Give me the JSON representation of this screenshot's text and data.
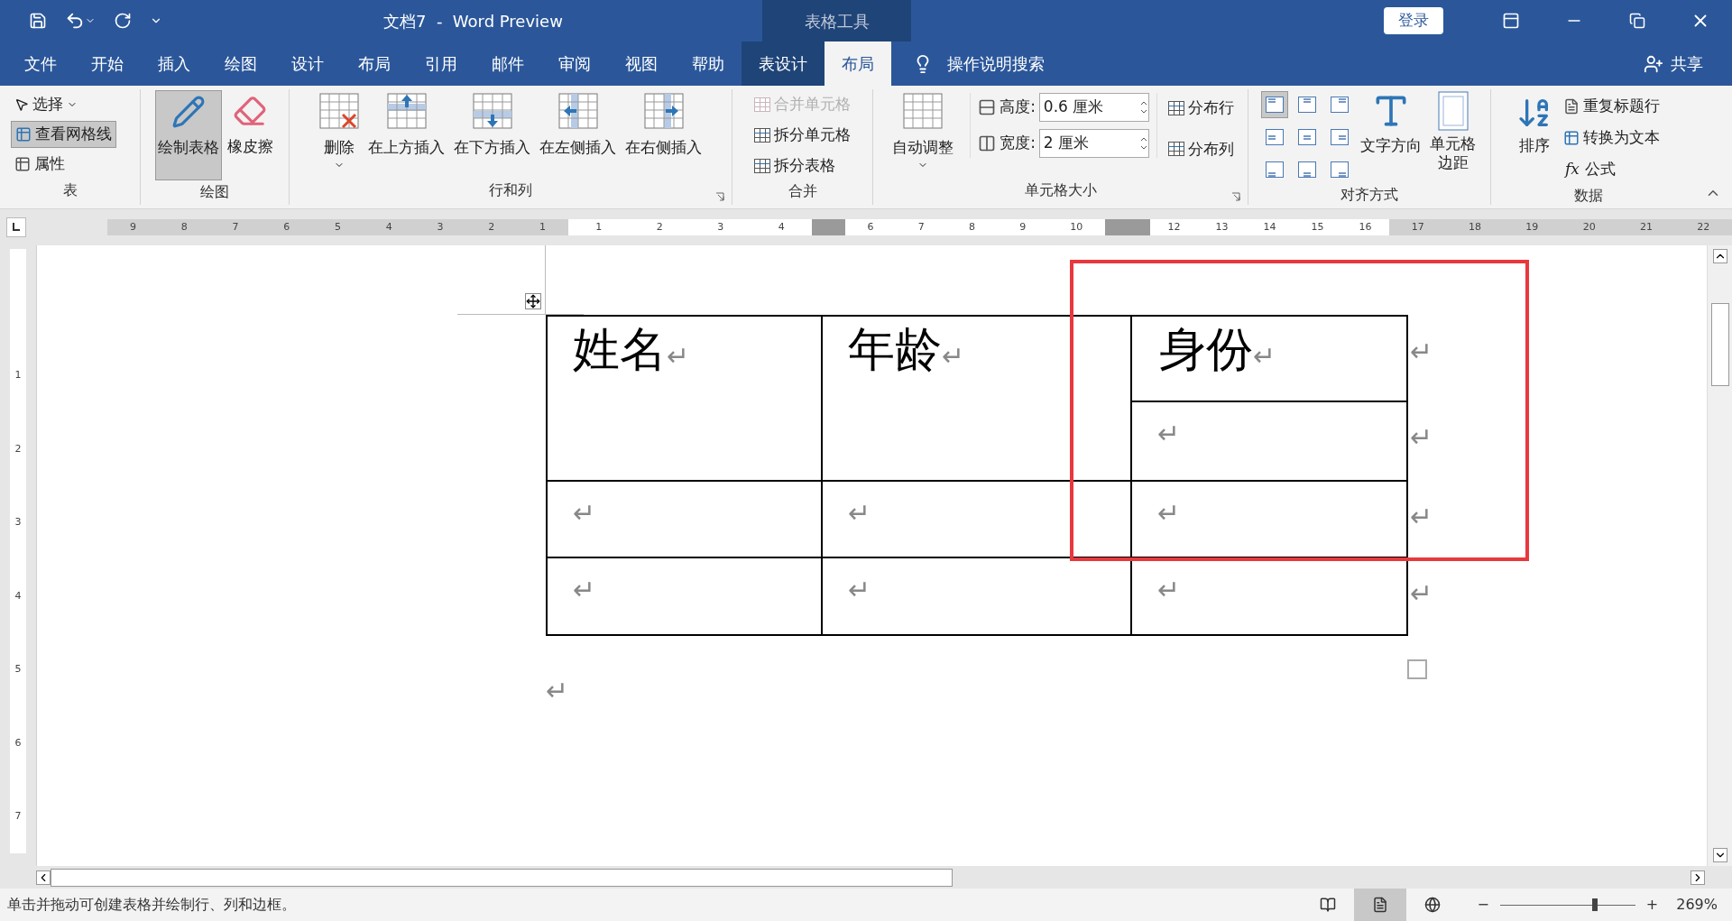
{
  "title_bar": {
    "title": "文档7  -  Word Preview",
    "context_label": "表格工具",
    "sign_in": "登录"
  },
  "tabs": [
    {
      "label": "文件",
      "selected": false,
      "kind": "normal"
    },
    {
      "label": "开始",
      "selected": false,
      "kind": "normal"
    },
    {
      "label": "插入",
      "selected": false,
      "kind": "normal"
    },
    {
      "label": "绘图",
      "selected": false,
      "kind": "normal"
    },
    {
      "label": "设计",
      "selected": false,
      "kind": "normal"
    },
    {
      "label": "布局",
      "selected": false,
      "kind": "normal"
    },
    {
      "label": "引用",
      "selected": false,
      "kind": "normal"
    },
    {
      "label": "邮件",
      "selected": false,
      "kind": "normal"
    },
    {
      "label": "审阅",
      "selected": false,
      "kind": "normal"
    },
    {
      "label": "视图",
      "selected": false,
      "kind": "normal"
    },
    {
      "label": "帮助",
      "selected": false,
      "kind": "normal"
    },
    {
      "label": "表设计",
      "selected": false,
      "kind": "context"
    },
    {
      "label": "布局",
      "selected": true,
      "kind": "context"
    }
  ],
  "tell_me": "操作说明搜索",
  "share": "共享",
  "ribbon": {
    "groups": [
      {
        "label": "表",
        "items": [
          {
            "label": "选择",
            "selected": false
          },
          {
            "label": "查看网格线",
            "selected": true
          },
          {
            "label": "属性",
            "selected": false
          }
        ]
      },
      {
        "label": "绘图",
        "items": [
          {
            "label": "绘制表格",
            "selected": true
          },
          {
            "label": "橡皮擦",
            "selected": false
          }
        ]
      },
      {
        "label": "行和列",
        "items": [
          {
            "label": "删除"
          },
          {
            "label": "在上方插入"
          },
          {
            "label": "在下方插入"
          },
          {
            "label": "在左侧插入"
          },
          {
            "label": "在右侧插入"
          }
        ]
      },
      {
        "label": "合并",
        "items": [
          {
            "label": "合并单元格",
            "disabled": true
          },
          {
            "label": "拆分单元格",
            "disabled": false
          },
          {
            "label": "拆分表格",
            "disabled": false
          }
        ]
      },
      {
        "label": "单元格大小",
        "autofit": "自动调整",
        "height_label": "高度:",
        "height_value": "0.6 厘米",
        "width_label": "宽度:",
        "width_value": "2 厘米",
        "items": [
          {
            "label": "分布行"
          },
          {
            "label": "分布列"
          }
        ]
      },
      {
        "label": "对齐方式",
        "align": [
          {
            "selected": true
          },
          {
            "selected": false
          },
          {
            "selected": false
          },
          {
            "selected": false
          },
          {
            "selected": false
          },
          {
            "selected": false
          },
          {
            "selected": false
          },
          {
            "selected": false
          },
          {
            "selected": false
          }
        ],
        "items": [
          {
            "label": "文字方向"
          },
          {
            "label": "单元格边距"
          }
        ]
      },
      {
        "label": "数据",
        "items": [
          {
            "label": "排序"
          },
          {
            "label": "重复标题行"
          },
          {
            "label": "转换为文本"
          },
          {
            "label": "公式",
            "icon_text": "fx"
          }
        ]
      }
    ]
  },
  "ruler": {
    "segments": [
      {
        "kind": "margin",
        "labels": [
          "9",
          "8",
          "7",
          "6",
          "5",
          "4",
          "3",
          "2",
          "1"
        ]
      },
      {
        "kind": "column",
        "labels": [
          "1",
          "2",
          "3",
          "4"
        ]
      },
      {
        "kind": "gap"
      },
      {
        "kind": "column",
        "labels": [
          "6",
          "7",
          "8",
          "9",
          "10"
        ]
      },
      {
        "kind": "gap"
      },
      {
        "kind": "column",
        "labels": [
          "12",
          "13",
          "14",
          "15",
          "16"
        ]
      },
      {
        "kind": "margin",
        "labels": [
          "17",
          "18",
          "19",
          "20",
          "21",
          "22"
        ]
      }
    ],
    "vertical_labels": [
      "1",
      "2",
      "3",
      "4",
      "5",
      "6",
      "7"
    ]
  },
  "table": {
    "header": [
      {
        "text": "姓名",
        "mark": "↵"
      },
      {
        "text": "年龄",
        "mark": "↵"
      },
      {
        "text": "身份",
        "mark": "↵"
      }
    ],
    "split_cell": {
      "mark": "↵"
    },
    "rows": [
      {
        "cells": [
          {
            "mark": "↵"
          },
          {
            "mark": "↵"
          },
          {
            "mark": "↵"
          }
        ]
      },
      {
        "cells": [
          {
            "mark": "↵"
          },
          {
            "mark": "↵"
          },
          {
            "mark": "↵"
          }
        ]
      }
    ],
    "end_marks": [
      "↵",
      "↵",
      "↵",
      "↵"
    ],
    "after_mark": "↵"
  },
  "status_bar": {
    "text": "单击并拖动可创建表格并绘制行、列和边框。",
    "views": [
      {
        "selected": false
      },
      {
        "selected": true
      },
      {
        "selected": false
      }
    ],
    "zoom_out": "−",
    "zoom_in": "+",
    "zoom": {
      "level": 0.7
    },
    "zoom_text": "269%"
  }
}
